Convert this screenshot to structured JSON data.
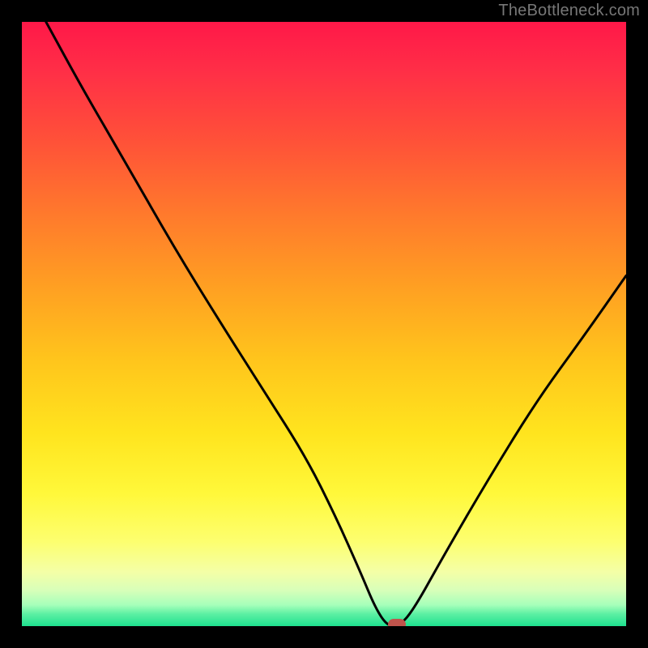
{
  "watermark": "TheBottleneck.com",
  "colors": {
    "frame": "#000000",
    "marker": "#c0544c",
    "curve": "#000000"
  },
  "chart_data": {
    "type": "line",
    "title": "",
    "xlabel": "",
    "ylabel": "",
    "xlim": [
      0,
      100
    ],
    "ylim": [
      0,
      100
    ],
    "grid": false,
    "legend": false,
    "annotations": [
      {
        "text": "TheBottleneck.com",
        "position": "top-right"
      }
    ],
    "series": [
      {
        "name": "bottleneck-curve",
        "description": "V-shaped bottleneck curve; minimum marks optimal match (≈0%).",
        "x": [
          4.0,
          10.0,
          17.0,
          25.0,
          33.0,
          40.0,
          47.0,
          52.0,
          56.0,
          58.5,
          60.5,
          62.5,
          65.0,
          70.0,
          77.0,
          85.0,
          93.0,
          100.0
        ],
        "y": [
          100.0,
          89.0,
          77.0,
          63.0,
          50.0,
          39.0,
          28.0,
          18.0,
          9.0,
          3.0,
          0.0,
          0.0,
          3.0,
          12.0,
          24.0,
          37.0,
          48.0,
          58.0
        ]
      }
    ],
    "marker": {
      "x": 62.0,
      "y": 0.0,
      "shape": "rounded-rect",
      "color": "#c0544c"
    },
    "background_gradient": {
      "direction": "vertical",
      "stops": [
        {
          "pos": 0.0,
          "color": "#ff1848"
        },
        {
          "pos": 0.2,
          "color": "#ff5238"
        },
        {
          "pos": 0.44,
          "color": "#ffa022"
        },
        {
          "pos": 0.68,
          "color": "#ffe41e"
        },
        {
          "pos": 0.86,
          "color": "#fdff6f"
        },
        {
          "pos": 0.96,
          "color": "#a6ffba"
        },
        {
          "pos": 1.0,
          "color": "#1ee08f"
        }
      ]
    }
  }
}
